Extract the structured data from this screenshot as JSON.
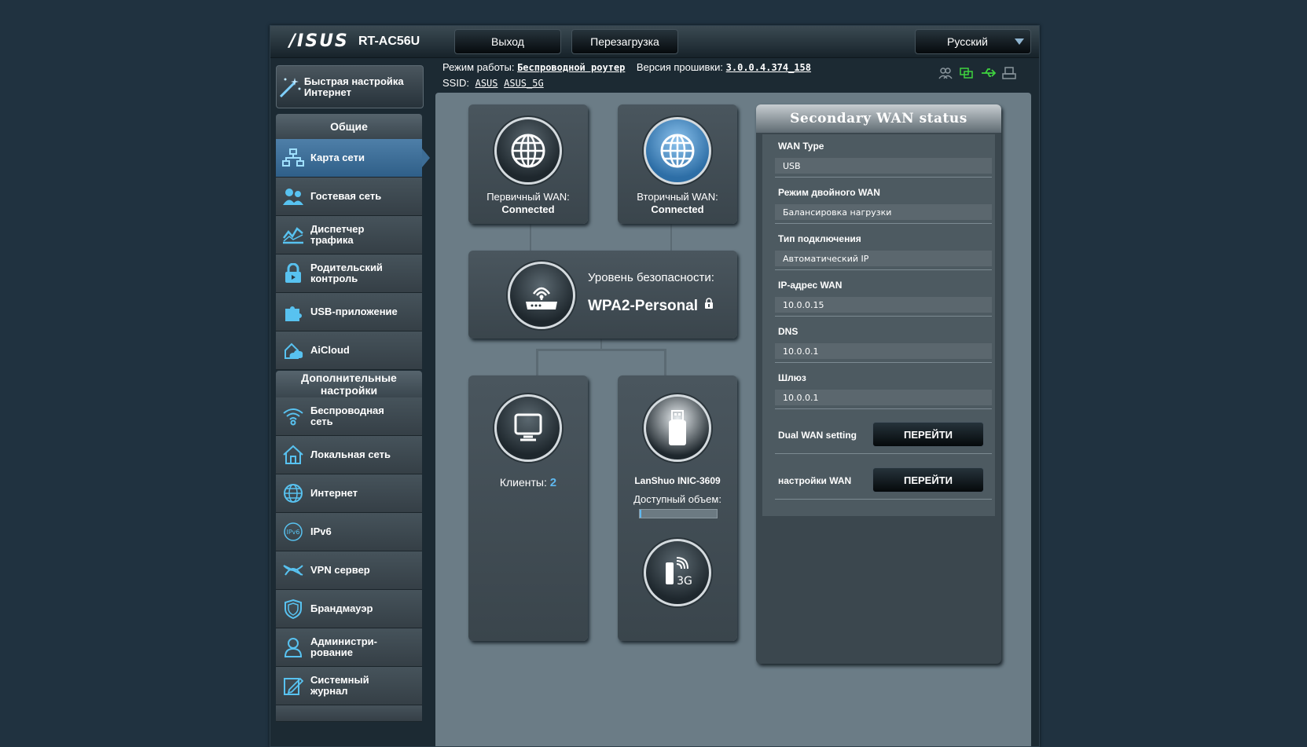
{
  "header": {
    "brand": "/ISUS",
    "model": "RT-AC56U",
    "logout_label": "Выход",
    "reboot_label": "Перезагрузка",
    "language": "Русский"
  },
  "info": {
    "mode_label": "Режим работы:",
    "mode_value": "Беспроводной роутер",
    "firmware_label": "Версия прошивки:",
    "firmware_value": "3.0.0.4.374_158",
    "ssid_label": "SSID:",
    "ssid_1": "ASUS",
    "ssid_2": "ASUS_5G"
  },
  "sidebar": {
    "quick_setup": "Быстрая настройка Интернет",
    "general_header": "Общие",
    "general_items": [
      {
        "label": "Карта сети",
        "icon": "network-map-icon",
        "active": true
      },
      {
        "label": "Гостевая сеть",
        "icon": "guest-network-icon"
      },
      {
        "label": "Диспетчер трафика",
        "icon": "traffic-manager-icon"
      },
      {
        "label": "Родительский контроль",
        "icon": "parental-control-icon"
      },
      {
        "label": "USB-приложение",
        "icon": "usb-app-icon"
      },
      {
        "label": "AiCloud",
        "icon": "aicloud-icon"
      }
    ],
    "advanced_header": "Дополнительные настройки",
    "advanced_items": [
      {
        "label": "Беспроводная сеть",
        "icon": "wireless-icon"
      },
      {
        "label": "Локальная сеть",
        "icon": "lan-icon"
      },
      {
        "label": "Интернет",
        "icon": "internet-globe-icon"
      },
      {
        "label": "IPv6",
        "icon": "ipv6-icon"
      },
      {
        "label": "VPN сервер",
        "icon": "vpn-icon"
      },
      {
        "label": "Брандмауэр",
        "icon": "firewall-icon"
      },
      {
        "label": "Администри-рование",
        "icon": "admin-icon"
      },
      {
        "label": "Системный журнал",
        "icon": "system-log-icon"
      }
    ]
  },
  "map": {
    "primary_wan_label": "Первичный WAN:",
    "primary_wan_status": "Connected",
    "secondary_wan_label": "Вторичный WAN:",
    "secondary_wan_status": "Connected",
    "security_label": "Уровень безопасности:",
    "security_value": "WPA2-Personal",
    "clients_label": "Клиенты:",
    "clients_count": "2",
    "usb_device": "LanShuo INIC-3609",
    "available_label": "Доступный объем:",
    "usb_3g_text": "3G"
  },
  "panel": {
    "title": "Secondary WAN status",
    "wan_type_label": "WAN Type",
    "wan_type_value": "USB",
    "dual_wan_mode_label": "Режим двойного WAN",
    "dual_wan_mode_value": "Балансировка нагрузки",
    "conn_type_label": "Тип подключения",
    "conn_type_value": "Автоматический IP",
    "wan_ip_label": "IP-адрес WAN",
    "wan_ip_value": "10.0.0.15",
    "dns_label": "DNS",
    "dns_value": "10.0.0.1",
    "gateway_label": "Шлюз",
    "gateway_value": "10.0.0.1",
    "dual_wan_setting_label": "Dual WAN setting",
    "wan_settings_label": "настройки WAN",
    "go_label": "ПЕРЕЙТИ"
  }
}
